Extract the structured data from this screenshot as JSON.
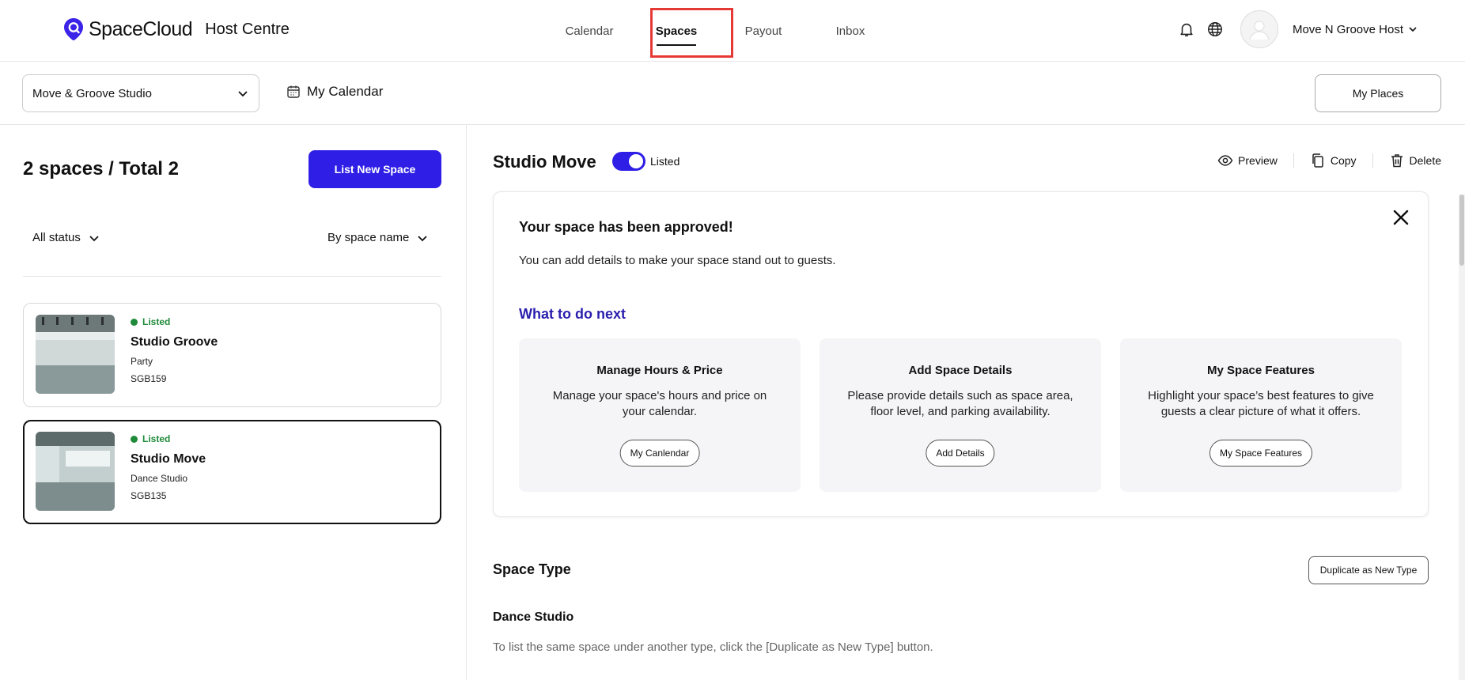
{
  "header": {
    "brand": "SpaceCloud",
    "brand_sub": "Host Centre",
    "nav": [
      {
        "label": "Calendar"
      },
      {
        "label": "Spaces"
      },
      {
        "label": "Payout"
      },
      {
        "label": "Inbox"
      }
    ],
    "active_nav": "Spaces",
    "user_name": "Move N Groove Host"
  },
  "subbar": {
    "studio_select": "Move & Groove Studio",
    "my_calendar": "My Calendar",
    "my_places": "My Places"
  },
  "left": {
    "count": "2 spaces / Total 2",
    "list_new": "List New Space",
    "filter_status": "All status",
    "filter_sort": "By space name",
    "spaces": [
      {
        "status": "Listed",
        "name": "Studio Groove",
        "type": "Party",
        "code": "SGB159",
        "selected": false
      },
      {
        "status": "Listed",
        "name": "Studio Move",
        "type": "Dance Studio",
        "code": "SGB135",
        "selected": true
      }
    ]
  },
  "detail": {
    "title": "Studio Move",
    "toggle_label": "Listed",
    "listed": true,
    "actions": {
      "preview": "Preview",
      "copy": "Copy",
      "delete": "Delete"
    },
    "banner": {
      "title": "Your space has been approved!",
      "text": "You can add details to make your space stand out to guests.",
      "next_title": "What to do next",
      "cards": [
        {
          "title": "Manage Hours & Price",
          "text": "Manage your space's hours and price on your calendar.",
          "button": "My Canlendar"
        },
        {
          "title": "Add Space Details",
          "text": "Please provide details such as space area, floor level, and parking availability.",
          "button": "Add Details"
        },
        {
          "title": "My Space Features",
          "text": "Highlight your space’s best features to give guests a clear picture of what it offers.",
          "button": "My Space Features"
        }
      ]
    },
    "space_type": {
      "title": "Space Type",
      "duplicate_button": "Duplicate as New Type",
      "type_name": "Dance Studio",
      "description": "To list the same space under another type, click the [Duplicate as New Type] button."
    }
  },
  "colors": {
    "accent": "#2e1ee6",
    "listed": "#1f8a3a",
    "highlight": "#e53935",
    "next_title": "#2a1fae"
  }
}
